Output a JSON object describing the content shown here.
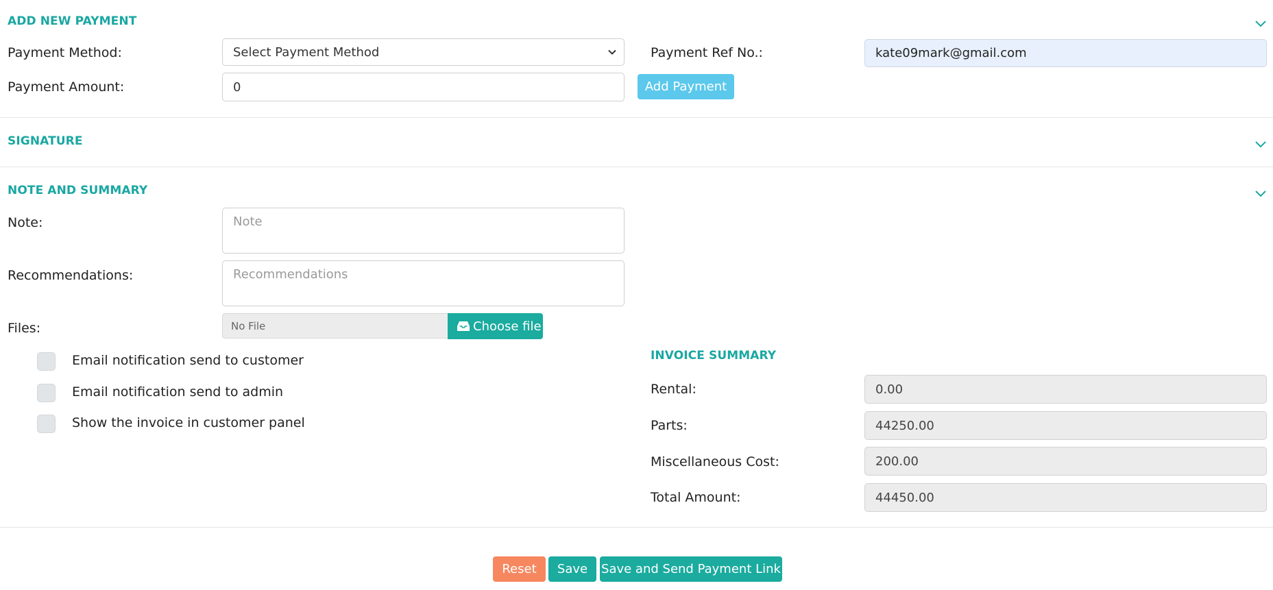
{
  "sections": {
    "payment_title": "ADD NEW PAYMENT",
    "signature_title": "SIGNATURE",
    "note_title": "NOTE AND SUMMARY",
    "invoice_title": "INVOICE SUMMARY"
  },
  "payment": {
    "method_label": "Payment Method:",
    "method_selected": "Select Payment Method",
    "ref_label": "Payment Ref No.:",
    "ref_value": "kate09mark@gmail.com",
    "amount_label": "Payment Amount:",
    "amount_value": "0",
    "add_button": "Add Payment"
  },
  "note": {
    "note_label": "Note:",
    "note_placeholder": "Note",
    "rec_label": "Recommendations:",
    "rec_placeholder": "Recommendations",
    "files_label": "Files:",
    "file_status": "No File",
    "choose_button": "Choose file"
  },
  "checkboxes": [
    {
      "label": "Email notification send to customer",
      "checked": false
    },
    {
      "label": "Email notification send to admin",
      "checked": false
    },
    {
      "label": "Show the invoice in customer panel",
      "checked": false
    }
  ],
  "invoice": {
    "rental_label": "Rental:",
    "rental_value": "0.00",
    "parts_label": "Parts:",
    "parts_value": "44250.00",
    "misc_label": "Miscellaneous Cost:",
    "misc_value": "200.00",
    "total_label": "Total Amount:",
    "total_value": "44450.00"
  },
  "actions": {
    "reset": "Reset",
    "save": "Save",
    "save_send": "Save and Send Payment Link"
  },
  "icons": {
    "collapse": "chevron-down-icon",
    "select": "chevron-down-icon",
    "file": "inbox-icon"
  },
  "colors": {
    "accent": "#1aa7a2",
    "button_teal": "#1bab9f",
    "button_info": "#5bc8ec",
    "button_reset": "#f6875f",
    "autofill_bg": "#e8f0fd"
  }
}
